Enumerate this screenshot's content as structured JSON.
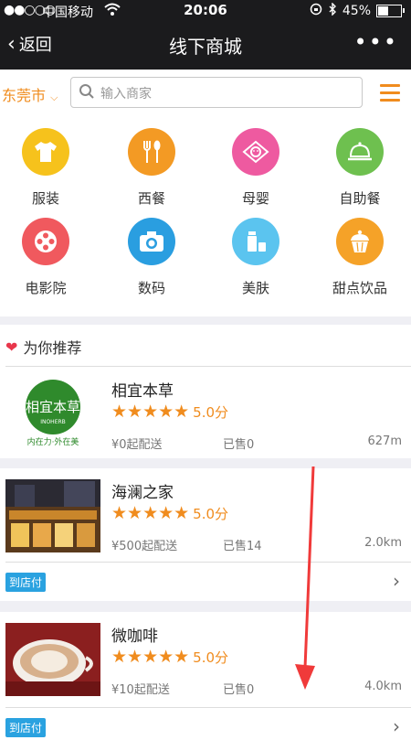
{
  "status_bar": {
    "signal": "●●○○○",
    "carrier": "中国移动",
    "time": "20:06",
    "battery": "45%",
    "battery_level": 0.45
  },
  "nav": {
    "back_label": "返回",
    "title": "线下商城",
    "more": "•••"
  },
  "search": {
    "city": "东莞市",
    "placeholder": "输入商家"
  },
  "categories": [
    {
      "label": "服装",
      "icon": "tshirt-icon",
      "color": "#f6c21c"
    },
    {
      "label": "西餐",
      "icon": "fork-spoon-icon",
      "color": "#f39a24"
    },
    {
      "label": "母婴",
      "icon": "baby-icon",
      "color": "#ee5aa0"
    },
    {
      "label": "自助餐",
      "icon": "food-cover-icon",
      "color": "#6ec04f"
    },
    {
      "label": "电影院",
      "icon": "film-reel-icon",
      "color": "#f0595e"
    },
    {
      "label": "数码",
      "icon": "camera-icon",
      "color": "#2a9ee0"
    },
    {
      "label": "美肤",
      "icon": "cosmetics-icon",
      "color": "#5bc4ef"
    },
    {
      "label": "甜点饮品",
      "icon": "cupcake-icon",
      "color": "#f5a228"
    }
  ],
  "recommend": {
    "title": "为你推荐"
  },
  "shops": [
    {
      "name": "相宜本草",
      "rating": "5.0分",
      "stars": "★★★★★",
      "min_delivery": "¥0起配送",
      "sold": "已售0",
      "distance": "627m",
      "tag": ""
    },
    {
      "name": "海澜之家",
      "rating": "5.0分",
      "stars": "★★★★★",
      "min_delivery": "¥500起配送",
      "sold": "已售14",
      "distance": "2.0km",
      "tag": "到店付"
    },
    {
      "name": "微咖啡",
      "rating": "5.0分",
      "stars": "★★★★★",
      "min_delivery": "¥10起配送",
      "sold": "已售0",
      "distance": "4.0km",
      "tag": "到店付"
    }
  ],
  "logo_text": {
    "brand": "相宜本草",
    "sub": "INOHERB",
    "slogan": "内在力·外在美"
  }
}
